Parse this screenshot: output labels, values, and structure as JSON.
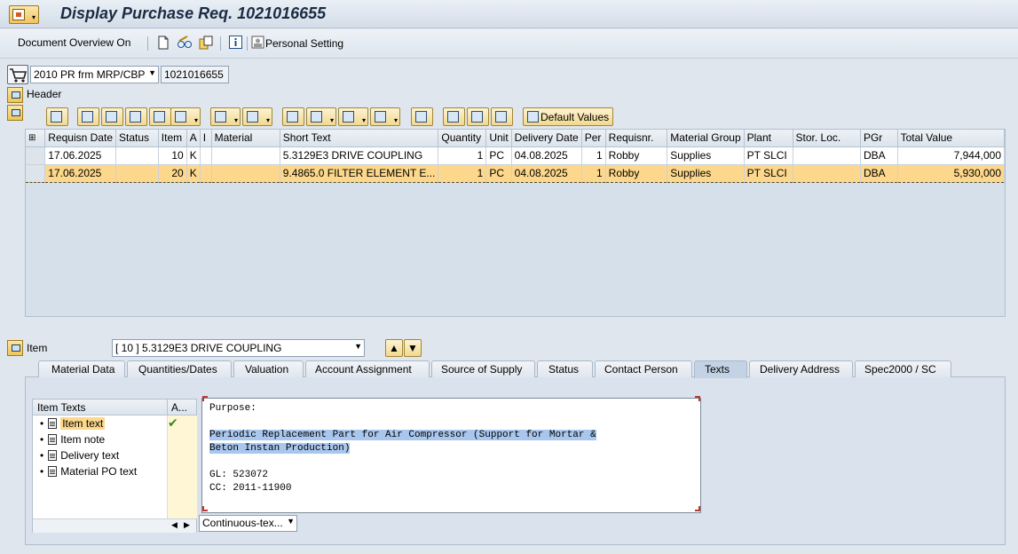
{
  "window": {
    "title": "Display Purchase Req. 1021016655"
  },
  "toolbar": {
    "doc_overview": "Document Overview On",
    "personal_setting": "Personal Setting",
    "icons": [
      "new-document-icon",
      "edit-glasses-icon",
      "copy-icon",
      "info-icon",
      "personal-setting-icon"
    ]
  },
  "doc": {
    "type": "2010 PR frm MRP/CBP",
    "number": "1021016655"
  },
  "header": {
    "label": "Header"
  },
  "alv": {
    "default_values": "Default Values"
  },
  "grid": {
    "columns": [
      "Requisn Date",
      "Status",
      "Item",
      "A",
      "I",
      "Material",
      "Short Text",
      "Quantity",
      "Unit",
      "Delivery Date",
      "Per",
      "Requisnr.",
      "Material Group",
      "Plant",
      "Stor. Loc.",
      "PGr",
      "Total Value"
    ],
    "rows": [
      [
        "17.06.2025",
        "",
        "10",
        "K",
        "",
        "",
        "5.3129E3 DRIVE COUPLING",
        "1",
        "PC",
        "04.08.2025",
        "1",
        "Robby",
        "Supplies",
        "PT SLCI",
        "",
        "DBA",
        "7,944,000"
      ],
      [
        "17.06.2025",
        "",
        "20",
        "K",
        "",
        "",
        "9.4865.0 FILTER ELEMENT E...",
        "1",
        "PC",
        "04.08.2025",
        "1",
        "Robby",
        "Supplies",
        "PT SLCI",
        "",
        "DBA",
        "5,930,000"
      ]
    ],
    "selected_row": 2
  },
  "item": {
    "label": "Item",
    "selected": "[ 10 ] 5.3129E3 DRIVE COUPLING"
  },
  "tabs": [
    "Material Data",
    "Quantities/Dates",
    "Valuation",
    "Account Assignment",
    "Source of Supply",
    "Status",
    "Contact Person",
    "Texts",
    "Delivery Address",
    "Spec2000 / SC"
  ],
  "active_tab": "Texts",
  "texts": {
    "col_header": "Item Texts",
    "col_a": "A...",
    "items": [
      "Item text",
      "Item note",
      "Delivery text",
      "Material PO text"
    ],
    "selected": "Item text",
    "editor_lines": [
      "Purpose:",
      "",
      "Periodic Replacement Part for Air Compressor (Support for Mortar &",
      "Beton Instan Production)",
      "",
      "GL: 523072",
      "CC: 2011-11900"
    ],
    "format": "Continuous-tex..."
  }
}
